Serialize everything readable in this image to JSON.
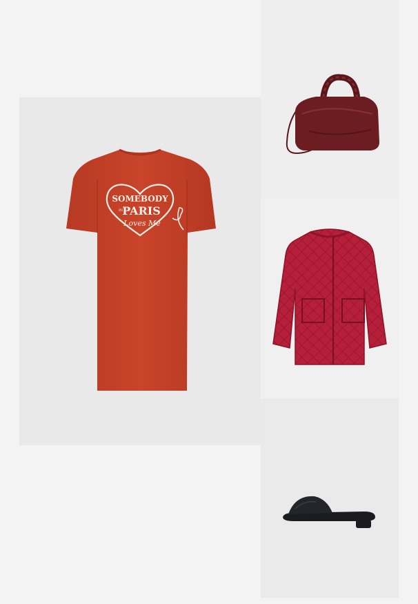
{
  "outfit": {
    "items": [
      {
        "id": "dress",
        "kind": "t-shirt dress",
        "color": "#c8442a",
        "print": {
          "line1": "SOMEBODY",
          "line2": "IN",
          "line3": "PARIS",
          "line4": "Loves Me"
        }
      },
      {
        "id": "bag",
        "kind": "handbag",
        "color": "#6b1d22"
      },
      {
        "id": "jacket",
        "kind": "quilted jacket",
        "color": "#b51f3a"
      },
      {
        "id": "sandal",
        "kind": "slide sandal",
        "color": "#1b1c1f"
      }
    ]
  },
  "colors": {
    "background": "#f3f3f3",
    "dress": "#c8442a",
    "bag": "#6b1d22",
    "jacket": "#b51f3a",
    "sandal": "#1b1c1f"
  }
}
